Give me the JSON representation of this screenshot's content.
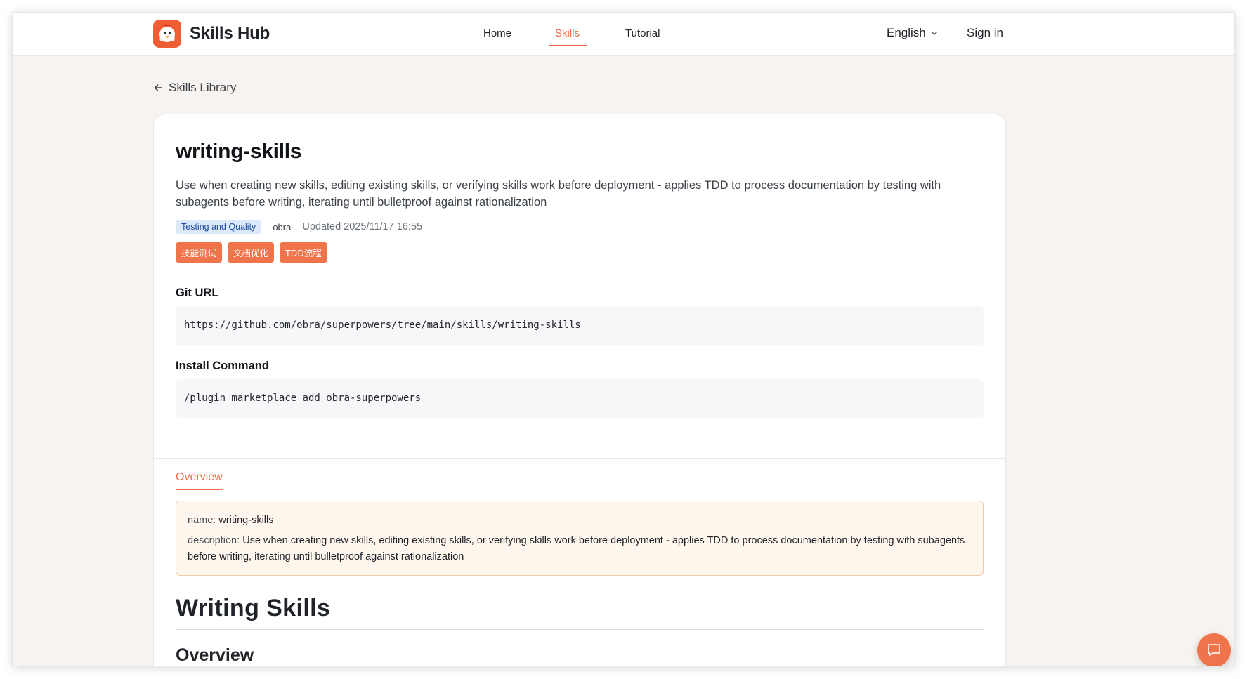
{
  "header": {
    "brand": "Skills Hub",
    "nav": {
      "home": "Home",
      "skills": "Skills",
      "tutorial": "Tutorial"
    },
    "language": "English",
    "sign_in": "Sign in",
    "active_color": "#ef6a45"
  },
  "breadcrumb": {
    "back_label": "Skills Library"
  },
  "skill": {
    "title": "writing-skills",
    "description": "Use when creating new skills, editing existing skills, or verifying skills work before deployment - applies TDD to process documentation by testing with subagents before writing, iterating until bulletproof against rationalization",
    "category": "Testing and Quality",
    "author": "obra",
    "updated": "Updated 2025/11/17 16:55",
    "tags": [
      "技能测试",
      "文档优化",
      "TDD流程"
    ],
    "git_url_label": "Git URL",
    "git_url": "https://github.com/obra/superpowers/tree/main/skills/writing-skills",
    "install_label": "Install Command",
    "install_command": "/plugin marketplace add obra-superpowers"
  },
  "tabs": {
    "overview": "Overview"
  },
  "frontmatter": {
    "name_key": "name:",
    "name_value": "writing-skills",
    "description_key": "description:",
    "description_value": "Use when creating new skills, editing existing skills, or verifying skills work before deployment - applies TDD to process documentation by testing with subagents before writing, iterating until bulletproof against rationalization"
  },
  "content": {
    "h1": "Writing Skills",
    "h2": "Overview"
  },
  "icons": {
    "logo": "chicken-logo-icon",
    "back": "arrow-left-icon",
    "language": "chevron-down-icon",
    "chat": "chat-bubble-icon"
  }
}
